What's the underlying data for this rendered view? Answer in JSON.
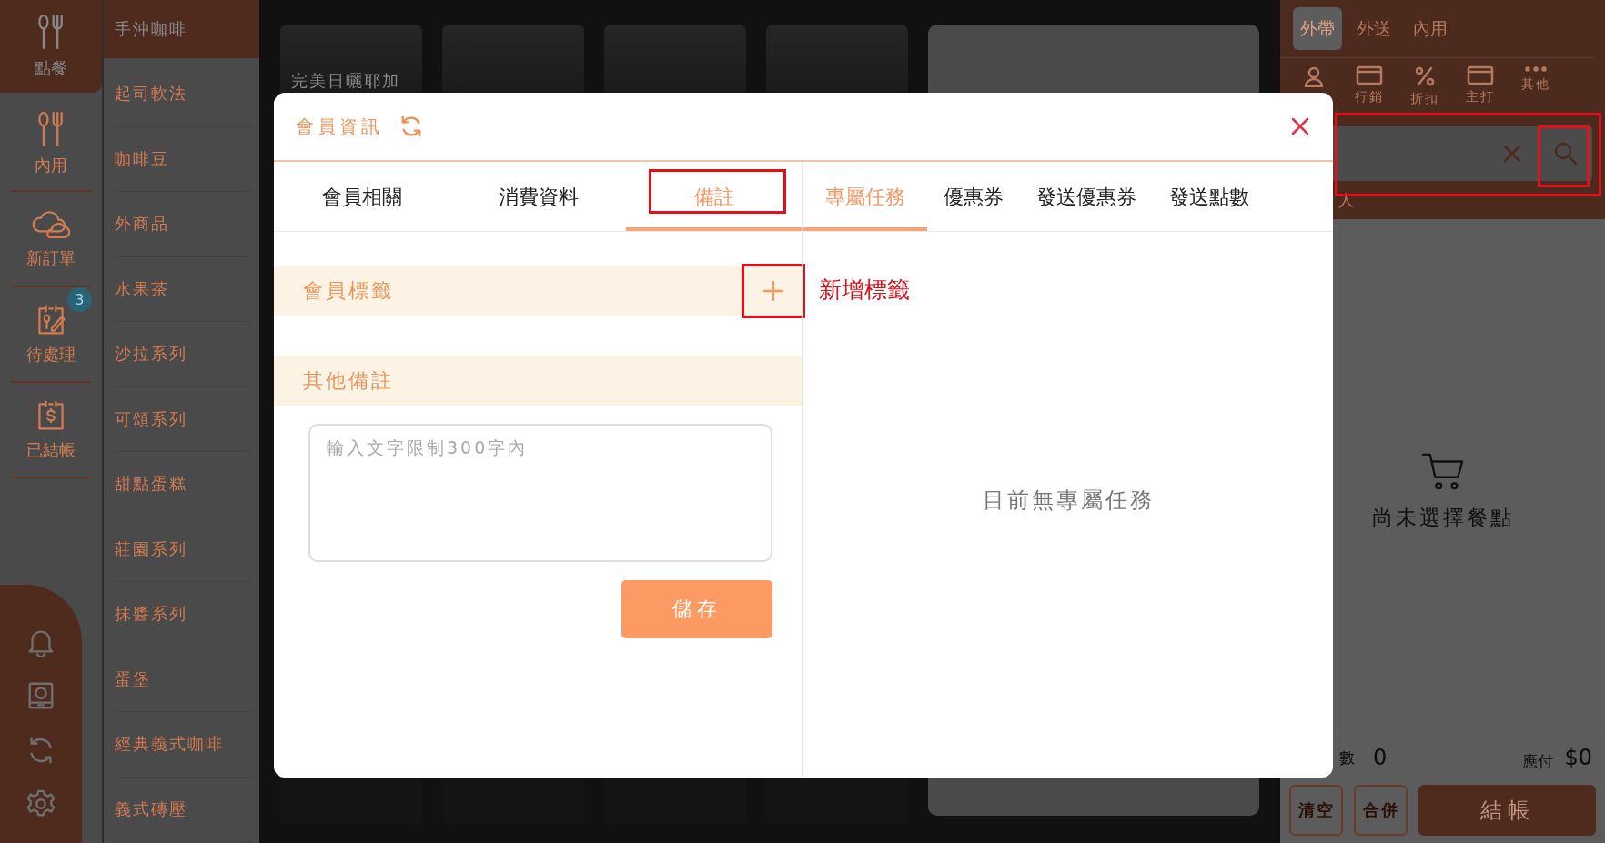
{
  "nav": {
    "items": [
      {
        "label": "點餐",
        "selected": true
      },
      {
        "label": "內用",
        "selected": false
      },
      {
        "label": "新訂單",
        "selected": false
      },
      {
        "label": "待處理",
        "selected": false,
        "badge": "3"
      },
      {
        "label": "已結帳",
        "selected": false
      }
    ]
  },
  "categories": [
    {
      "label": "手沖咖啡",
      "selected": true
    },
    {
      "label": "起司軟法",
      "selected": false
    },
    {
      "label": "咖啡豆",
      "selected": false
    },
    {
      "label": "外商品",
      "selected": false
    },
    {
      "label": "水果茶",
      "selected": false
    },
    {
      "label": "沙拉系列",
      "selected": false
    },
    {
      "label": "可頌系列",
      "selected": false
    },
    {
      "label": "甜點蛋糕",
      "selected": false
    },
    {
      "label": "莊園系列",
      "selected": false
    },
    {
      "label": "抹醬系列",
      "selected": false
    },
    {
      "label": "蛋堡",
      "selected": false
    },
    {
      "label": "經典義式咖啡",
      "selected": false
    },
    {
      "label": "義式磚壓",
      "selected": false
    }
  ],
  "product_cards": [
    {
      "name": "完美日曬耶加"
    }
  ],
  "order_panel": {
    "order_types": [
      {
        "label": "外帶",
        "selected": true
      },
      {
        "label": "外送",
        "selected": false
      },
      {
        "label": "內用",
        "selected": false
      }
    ],
    "actions": [
      {
        "label": "行銷"
      },
      {
        "label": "折扣"
      },
      {
        "label": "主打"
      },
      {
        "label": "其他"
      }
    ],
    "people_fragment": "人",
    "empty_message": "尚未選擇餐點",
    "count_label_fragment": "數",
    "count": "0",
    "amount_label": "應付",
    "amount": "$0",
    "buttons": [
      {
        "label": "清空",
        "kind": "outline"
      },
      {
        "label": "合併",
        "kind": "outline"
      },
      {
        "label": "結帳",
        "kind": "primary"
      }
    ]
  },
  "modal": {
    "title": "會員資訊",
    "left_tabs": [
      {
        "label": "會員相關",
        "selected": false
      },
      {
        "label": "消費資料",
        "selected": false
      },
      {
        "label": "備註",
        "selected": true
      }
    ],
    "right_tabs": [
      {
        "label": "專屬任務",
        "selected": true
      },
      {
        "label": "優惠券",
        "selected": false
      },
      {
        "label": "發送優惠券",
        "selected": false
      },
      {
        "label": "發送點數",
        "selected": false
      }
    ],
    "sections": [
      {
        "title": "會員標籤",
        "kind": "tags"
      },
      {
        "title": "其他備註",
        "kind": "note"
      }
    ],
    "note_placeholder": "輸入文字限制300字內",
    "save_button": "儲存",
    "empty_message": "目前無專屬任務"
  },
  "annotation": {
    "text": "新增標籤"
  }
}
